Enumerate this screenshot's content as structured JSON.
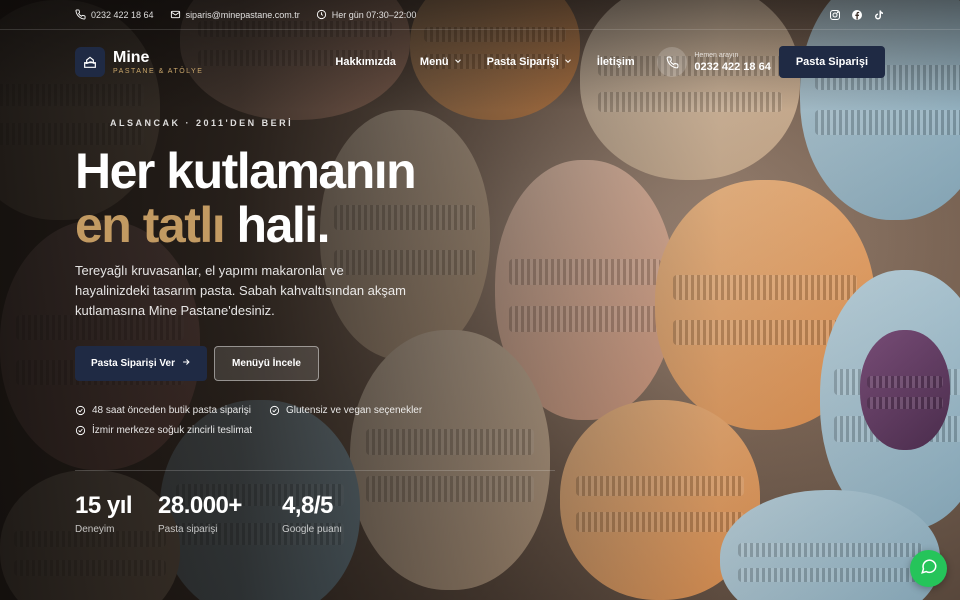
{
  "topbar": {
    "phone": "0232 422 18 64",
    "email": "siparis@minepastane.com.tr",
    "hours": "Her gün 07:30–22:00"
  },
  "brand": {
    "name": "Mine",
    "subtitle": "PASTANE & ATÖLYE"
  },
  "nav": {
    "items": [
      {
        "label": "Hakkımızda"
      },
      {
        "label": "Menü"
      },
      {
        "label": "Pasta Siparişi"
      },
      {
        "label": "İletişim"
      }
    ],
    "help_label": "Hemen arayın",
    "help_phone": "0232 422 18 64",
    "cta": "Pasta Siparişi"
  },
  "hero": {
    "eyebrow": "ALSANCAK · 2011'DEN BERİ",
    "title_line1": "Her kutlamanın",
    "title_gold": "en tatlı",
    "title_rest": " hali.",
    "lead": "Tereyağlı kruvasanlar, el yapımı makaronlar ve hayalinizdeki tasarım pasta. Sabah kahvaltısından akşam kutlamasına Mine Pastane'desiniz.",
    "primary_button": "Pasta Siparişi Ver",
    "secondary_button": "Menüyü İncele",
    "features": [
      "48 saat önceden butik pasta siparişi",
      "Glutensiz ve vegan seçenekler",
      "İzmir merkeze soğuk zincirli teslimat"
    ],
    "stats": [
      {
        "value": "15 yıl",
        "label": "Deneyim"
      },
      {
        "value": "28.000+",
        "label": "Pasta siparişi"
      },
      {
        "value": "4,8/5",
        "label": "Google puanı"
      }
    ]
  },
  "colors": {
    "navy": "#1f2a44",
    "gold": "#c29a62",
    "whatsapp": "#25c45a"
  }
}
